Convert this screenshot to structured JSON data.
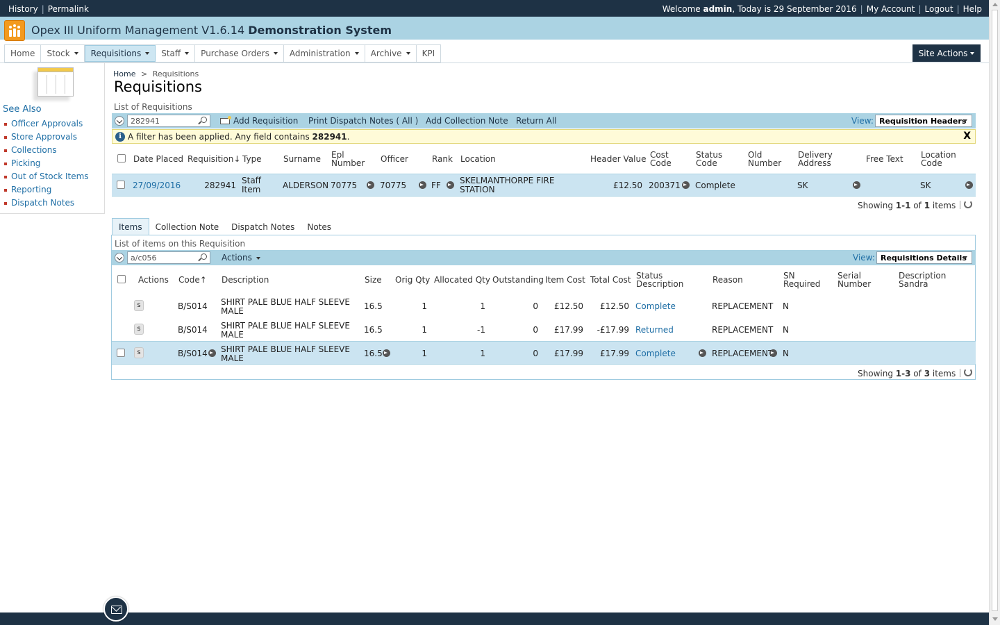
{
  "topbar": {
    "history": "History",
    "permalink": "Permalink",
    "welcome_prefix": "Welcome",
    "user": "admin",
    "today_text": ", Today is 29 September 2016",
    "my_account": "My Account",
    "logout": "Logout",
    "help": "Help"
  },
  "app": {
    "title_plain": "Opex III Uniform Management V1.6.14",
    "title_bold": "Demonstration System"
  },
  "nav": {
    "items": [
      {
        "label": "Home"
      },
      {
        "label": "Stock"
      },
      {
        "label": "Requisitions"
      },
      {
        "label": "Staff"
      },
      {
        "label": "Purchase Orders"
      },
      {
        "label": "Administration"
      },
      {
        "label": "Archive"
      },
      {
        "label": "KPI"
      }
    ],
    "site_actions": "Site Actions"
  },
  "sidebar": {
    "heading": "See Also",
    "items": [
      {
        "label": "Officer Approvals"
      },
      {
        "label": "Store Approvals"
      },
      {
        "label": "Collections"
      },
      {
        "label": "Picking"
      },
      {
        "label": "Out of Stock Items"
      },
      {
        "label": "Reporting"
      },
      {
        "label": "Dispatch Notes"
      }
    ]
  },
  "breadcrumb": {
    "home": "Home",
    "sep": ">",
    "current": "Requisitions"
  },
  "page": {
    "title": "Requisitions",
    "list_title": "List of Requisitions"
  },
  "req_toolbar": {
    "search_value": "282941",
    "add": "Add Requisition",
    "print": "Print Dispatch Notes ( All )",
    "collection": "Add Collection Note",
    "return_all": "Return All",
    "view_label": "View:",
    "view_value": "Requisition Headers"
  },
  "filter": {
    "info_glyph": "i",
    "text": "A filter has been applied. Any field contains",
    "value": "282941",
    "suffix": ".",
    "close": "X"
  },
  "req_table": {
    "headers": {
      "date": "Date Placed",
      "requisition": "Requisition",
      "type": "Type",
      "surname": "Surname",
      "epl1": "Epl",
      "epl2": "Number",
      "officer": "Officer",
      "rank": "Rank",
      "location": "Location",
      "header_value": "Header Value",
      "cost1": "Cost",
      "cost2": "Code",
      "status1": "Status",
      "status2": "Code",
      "old1": "Old",
      "old2": "Number",
      "delivery1": "Delivery",
      "delivery2": "Address",
      "free_text": "Free Text",
      "loc1": "Location",
      "loc2": "Code"
    },
    "sort_arrow": "↓",
    "row": {
      "date": "27/09/2016",
      "requisition": "282941",
      "type1": "Staff",
      "type2": "Item",
      "surname": "ALDERSON",
      "epl": "70775",
      "officer": "70775",
      "rank": "FF",
      "location1": "SKELMANTHORPE FIRE",
      "location2": "STATION",
      "header_value": "£12.50",
      "cost_code": "200371",
      "status": "Complete",
      "delivery": "SK",
      "location_code": "SK"
    },
    "showing": {
      "prefix": "Showing",
      "range": "1-1",
      "of": "of",
      "total": "1",
      "suffix": "items"
    }
  },
  "tabs": [
    {
      "label": "Items"
    },
    {
      "label": "Collection Note"
    },
    {
      "label": "Dispatch Notes"
    },
    {
      "label": "Notes"
    }
  ],
  "items": {
    "list_title": "List of items on this Requisition",
    "search_value": "a/c056",
    "actions": "Actions",
    "view_label": "View:",
    "view_value": "Requisitions Details",
    "headers": {
      "actions": "Actions",
      "code": "Code",
      "description": "Description",
      "size": "Size",
      "orig_qty": "Orig Qty",
      "allocated": "Allocated Qty",
      "outstanding": "Outstanding",
      "item_cost": "Item Cost",
      "total_cost": "Total Cost",
      "status1": "Status",
      "status2": "Description",
      "reason": "Reason",
      "sn1": "SN",
      "sn2": "Required",
      "serial1": "Serial",
      "serial2": "Number",
      "desc_sandra1": "Description",
      "desc_sandra2": "Sandra"
    },
    "sort_arrow": "↑",
    "s_label": "s",
    "rows": [
      {
        "code": "B/S014",
        "desc1": "SHIRT PALE BLUE HALF SLEEVE",
        "desc2": "MALE",
        "size": "16.5",
        "orig": "1",
        "alloc": "1",
        "out": "0",
        "item_cost": "£12.50",
        "total_cost": "£12.50",
        "status": "Complete",
        "reason": "REPLACEMENT",
        "sn": "N"
      },
      {
        "code": "B/S014",
        "desc1": "SHIRT PALE BLUE HALF SLEEVE",
        "desc2": "MALE",
        "size": "16.5",
        "orig": "1",
        "alloc": "-1",
        "out": "0",
        "item_cost": "£17.99",
        "total_cost": "-£17.99",
        "status": "Returned",
        "reason": "REPLACEMENT",
        "sn": "N"
      },
      {
        "code": "B/S014",
        "desc1": "SHIRT PALE BLUE HALF SLEEVE",
        "desc2": "MALE",
        "size": "16.5",
        "orig": "1",
        "alloc": "1",
        "out": "0",
        "item_cost": "£17.99",
        "total_cost": "£17.99",
        "status": "Complete",
        "reason": "REPLACEMENT",
        "sn": "N"
      }
    ],
    "showing": {
      "prefix": "Showing",
      "range": "1-3",
      "of": "of",
      "total": "3",
      "suffix": "items"
    }
  }
}
